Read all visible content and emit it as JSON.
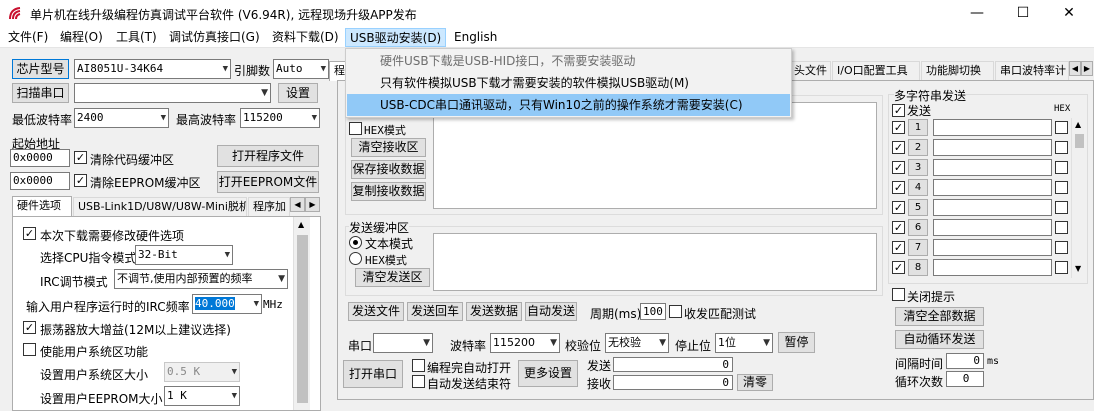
{
  "title": "单片机在线升级编程仿真调试平台软件 (V6.94R), 远程现场升级APP发布",
  "window_controls": {
    "minimize": "—",
    "maximize": "☐",
    "close": "✕"
  },
  "menu": [
    "文件(F)",
    "编程(O)",
    "工具(T)",
    "调试仿真接口(G)",
    "资料下载(D)",
    "USB驱动安装(D)",
    "English"
  ],
  "dropdown": [
    "硬件USB下载是USB-HID接口，不需要安装驱动",
    "只有软件模拟USB下载才需要安装的软件模拟USB驱动(M)",
    "USB-CDC串口通讯驱动，只有Win10之前的操作系统才需要安装(C)"
  ],
  "left": {
    "chip_btn": "芯片型号",
    "chip_value": "AI8051U-34K64",
    "pin_label": "引脚数",
    "pin_value": "Auto",
    "scan_btn": "扫描串口",
    "port_value": "",
    "settings_btn": "设置",
    "min_baud_label": "最低波特率",
    "min_baud_value": "2400",
    "max_baud_label": "最高波特率",
    "max_baud_value": "115200",
    "start_addr_label": "起始地址",
    "addr1": "0x0000",
    "clear_code": "清除代码缓冲区",
    "open_prog": "打开程序文件",
    "addr2": "0x0000",
    "clear_eeprom": "清除EEPROM缓冲区",
    "open_eeprom": "打开EEPROM文件",
    "tabs": [
      "硬件选项",
      "USB-Link1D/U8W/U8W-Mini脱机",
      "程序加"
    ],
    "hw": {
      "opt_hw": "本次下载需要修改硬件选项",
      "cpu_mode_label": "选择CPU指令模式",
      "cpu_mode_value": "32-Bit",
      "irc_label": "IRC调节模式",
      "irc_value": "不调节,使用内部预置的频率",
      "irc_freq_label": "输入用户程序运行时的IRC频率",
      "irc_freq_value": "40.000",
      "mhz": "MHz",
      "osc_gain": "振荡器放大增益(12M以上建议选择)",
      "user_sys": "使能用户系统区功能",
      "sys_size_label": "设置用户系统区大小",
      "sys_size_value": "0.5 K",
      "eeprom_size_label": "设置用户EEPROM大小",
      "eeprom_size_value": "1  K"
    }
  },
  "right_tabs": [
    "程",
    "头文件",
    "I/O口配置工具",
    "功能脚切换",
    "串口波特率计"
  ],
  "serial": {
    "hex_mode": "HEX模式",
    "clear_recv": "清空接收区",
    "save_recv": "保存接收数据",
    "copy_recv": "复制接收数据",
    "send_buffer": "发送缓冲区",
    "text_mode": "文本模式",
    "hex_mode2": "HEX模式",
    "clear_send": "清空发送区",
    "send_file": "发送文件",
    "send_return": "发送回车",
    "send_data": "发送数据",
    "auto_send": "自动发送",
    "period_label": "周期(ms)",
    "period_value": "100",
    "recv_match": "收发匹配测试",
    "port_label": "串口",
    "baud_label": "波特率",
    "baud_value": "115200",
    "parity_label": "校验位",
    "parity_value": "无校验",
    "stop_label": "停止位",
    "stop_value": "1位",
    "pause": "暂停",
    "open_port": "打开串口",
    "auto_open": "编程完自动打开",
    "auto_close": "自动发送结束符",
    "more_settings": "更多设置",
    "send_label": "发送",
    "send_count": "0",
    "recv_label": "接收",
    "recv_count": "0",
    "clear_count": "清零"
  },
  "multi": {
    "title": "多字符串发送",
    "send_col": "发送",
    "hex_col": "HEX",
    "rows": [
      "1",
      "2",
      "3",
      "4",
      "5",
      "6",
      "7",
      "8"
    ],
    "close_tip": "关闭提示",
    "clear_all": "清空全部数据",
    "auto_loop": "自动循环发送",
    "interval_label": "间隔时间",
    "interval_value": "0",
    "ms": "ms",
    "loop_label": "循环次数",
    "loop_value": "0"
  }
}
